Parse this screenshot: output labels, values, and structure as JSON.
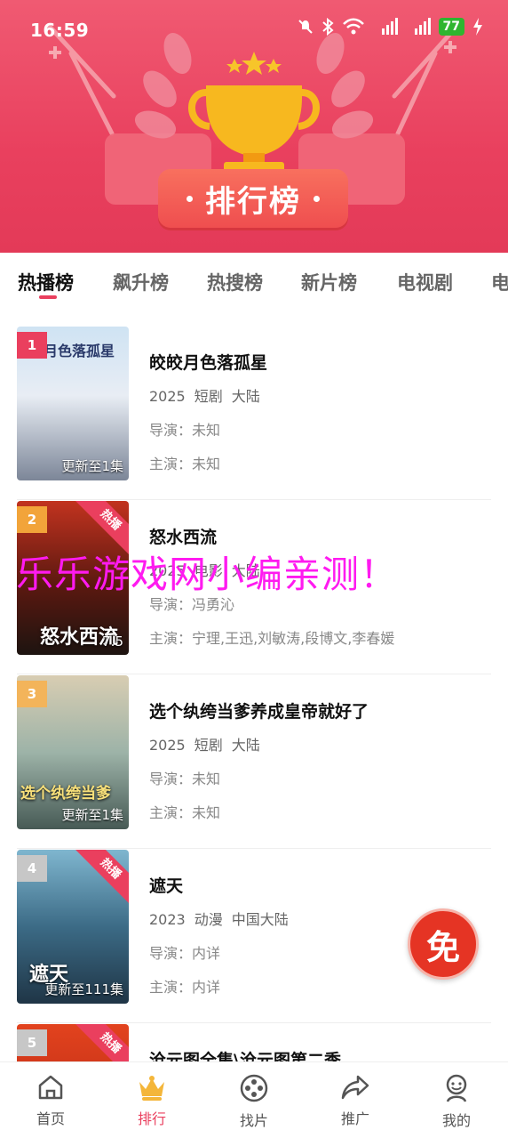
{
  "status_bar": {
    "time": "16:59",
    "battery": "77"
  },
  "banner": {
    "title": "排行榜"
  },
  "tabs": [
    "热播榜",
    "飙升榜",
    "热搜榜",
    "新片榜",
    "电视剧",
    "电"
  ],
  "list": [
    {
      "rank": "1",
      "name": "皎皎月色落孤星",
      "year": "2025",
      "type": "短剧",
      "region": "大陆",
      "director": "导演：未知",
      "cast": "主演：未知",
      "update": "更新至1集",
      "poster_text": "月色落孤星",
      "hot": ""
    },
    {
      "rank": "2",
      "name": "怒水西流",
      "year": "2025",
      "type": "电影",
      "region": "大陆",
      "director": "导演：冯勇沁",
      "cast": "主演：宁理,王迅,刘敏涛,段博文,李春媛",
      "update": "7.5",
      "poster_text": "怒水西流",
      "hot": "热播"
    },
    {
      "rank": "3",
      "name": "选个纨绔当爹养成皇帝就好了",
      "year": "2025",
      "type": "短剧",
      "region": "大陆",
      "director": "导演：未知",
      "cast": "主演：未知",
      "update": "更新至1集",
      "poster_text": "选个纨绔当爹",
      "hot": ""
    },
    {
      "rank": "4",
      "name": "遮天",
      "year": "2023",
      "type": "动漫",
      "region": "中国大陆",
      "director": "导演：内详",
      "cast": "主演：内详",
      "update": "更新至111集",
      "poster_text": "遮天",
      "hot": "热播"
    },
    {
      "rank": "5",
      "name": "沧元图全集\\沧元图第二季",
      "year": "",
      "type": "",
      "region": "",
      "director": "",
      "cast": "",
      "update": "",
      "poster_text": "",
      "hot": "热播"
    }
  ],
  "watermark": "乐乐游戏网小编亲测！",
  "free_button": "免",
  "bottom_nav": [
    {
      "label": "首页",
      "icon": "home-icon"
    },
    {
      "label": "排行",
      "icon": "crown-icon"
    },
    {
      "label": "找片",
      "icon": "film-reel-icon"
    },
    {
      "label": "推广",
      "icon": "share-icon"
    },
    {
      "label": "我的",
      "icon": "profile-icon"
    }
  ],
  "colors": {
    "accent": "#ea3f5e",
    "banner": "#e9405e",
    "free": "#e53424"
  }
}
